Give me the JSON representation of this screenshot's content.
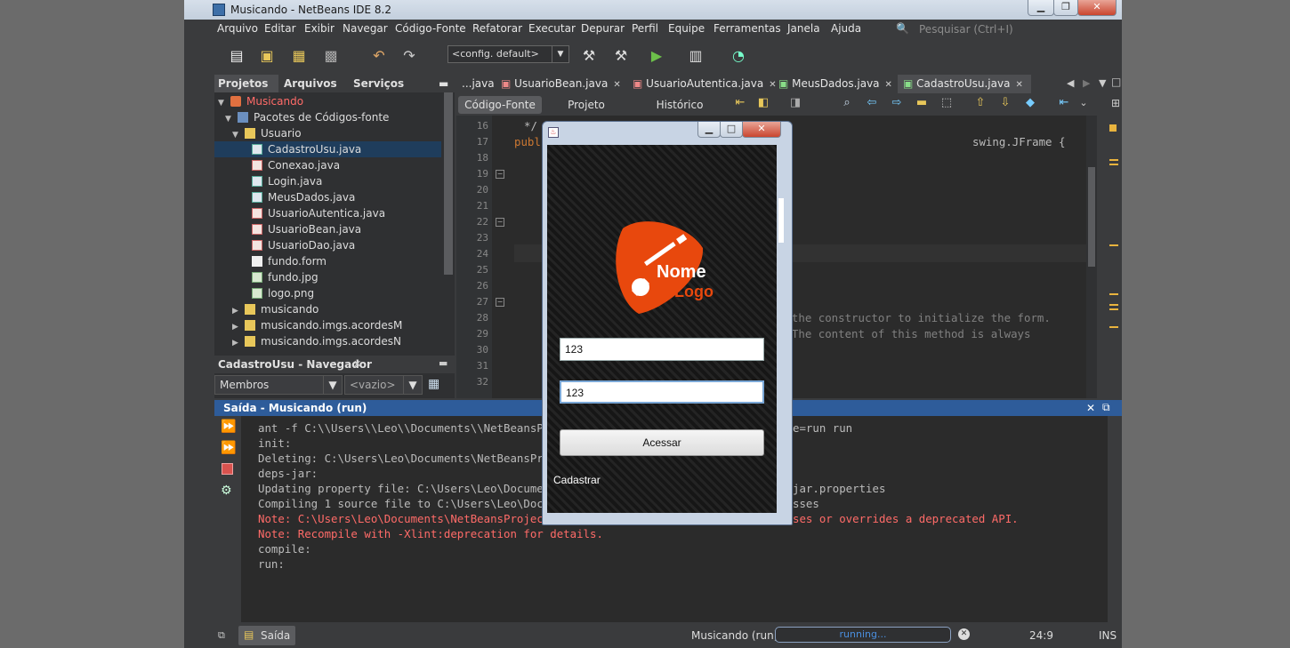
{
  "window": {
    "title": "Musicando - NetBeans IDE 8.2"
  },
  "menu": [
    "Arquivo",
    "Editar",
    "Exibir",
    "Navegar",
    "Código-Fonte",
    "Refatorar",
    "Executar",
    "Depurar",
    "Perfil",
    "Equipe",
    "Ferramentas",
    "Janela",
    "Ajuda"
  ],
  "search": {
    "placeholder": "Pesquisar (Ctrl+I)"
  },
  "toolbar": {
    "config": "<config. default>"
  },
  "left_tabs": [
    "Projetos",
    "Arquivos",
    "Serviços"
  ],
  "tree": [
    {
      "label": "Musicando",
      "icon": "project-icon",
      "color": "#ff6b68"
    },
    {
      "label": "Pacotes de Códigos-fonte",
      "icon": "source-packages-icon"
    },
    {
      "label": "Usuario",
      "icon": "package-icon"
    },
    {
      "label": "CadastroUsu.java",
      "icon": "java-form-icon"
    },
    {
      "label": "Conexao.java",
      "icon": "java-file-icon"
    },
    {
      "label": "Login.java",
      "icon": "java-form-icon"
    },
    {
      "label": "MeusDados.java",
      "icon": "java-form-icon"
    },
    {
      "label": "UsuarioAutentica.java",
      "icon": "java-file-icon"
    },
    {
      "label": "UsuarioBean.java",
      "icon": "java-file-icon"
    },
    {
      "label": "UsuarioDao.java",
      "icon": "java-file-icon"
    },
    {
      "label": "fundo.form",
      "icon": "form-file-icon"
    },
    {
      "label": "fundo.jpg",
      "icon": "image-file-icon"
    },
    {
      "label": "logo.png",
      "icon": "image-file-icon"
    },
    {
      "label": "musicando",
      "icon": "package-icon"
    },
    {
      "label": "musicando.imgs.acordesM",
      "icon": "package-icon"
    },
    {
      "label": "musicando.imgs.acordesN",
      "icon": "package-icon"
    }
  ],
  "navigator": {
    "title": "CadastroUsu - Navegador",
    "members": "Membros",
    "empty": "<vazio>"
  },
  "editor_tabs": [
    "...java",
    "UsuarioBean.java",
    "UsuarioAutentica.java",
    "MeusDados.java",
    "CadastroUsu.java"
  ],
  "sub_tabs": [
    "Código-Fonte",
    "Projeto",
    "Histórico"
  ],
  "line_numbers": [
    "16",
    "17",
    "18",
    "19",
    "20",
    "21",
    "22",
    "23",
    "24",
    "25",
    "26",
    "27",
    "28",
    "29",
    "30",
    "31",
    "32"
  ],
  "code": {
    "l16": "*/",
    "l17a": "publ",
    "l17b": "swing.JFrame {",
    "l28": "n the constructor to initialize the form.",
    "l29": ". The content of this method is always"
  },
  "output": {
    "title": "Saída - Musicando (run)",
    "lines": [
      {
        "text": "ant -f C:\\\\Users\\\\Leo\\\\Documents\\\\NetBeansProj",
        "tail": "e=run run",
        "red": false
      },
      {
        "text": "init:",
        "tail": "",
        "red": false
      },
      {
        "text": "Deleting: C:\\Users\\Leo\\Documents\\NetBeansProje",
        "tail": "",
        "red": false
      },
      {
        "text": "deps-jar:",
        "tail": "",
        "red": false
      },
      {
        "text": "Updating property file: C:\\Users\\Leo\\Document",
        "tail": "jar.properties",
        "red": false
      },
      {
        "text": "Compiling 1 source file to C:\\Users\\Leo\\Docume",
        "tail": "sses",
        "red": false
      },
      {
        "text": "Note: C:\\Users\\Leo\\Documents\\NetBeansProjects",
        "tail": "ses or overrides a deprecated API.",
        "red": true
      },
      {
        "text": "Note: Recompile with -Xlint:deprecation for details.",
        "tail": "",
        "red": true
      },
      {
        "text": "compile:",
        "tail": "",
        "red": false
      },
      {
        "text": "run:",
        "tail": "",
        "red": false
      }
    ]
  },
  "status": {
    "tab": "Saída",
    "project": "Musicando (run)",
    "progress": "running...",
    "position": "24:9",
    "mode": "INS"
  },
  "dialog": {
    "logo_line1": "Nome",
    "logo_line2": "Logo",
    "field1": "123",
    "field2": "123",
    "button": "Acessar",
    "link": "Cadastrar"
  },
  "colors": {
    "accent": "#2e5c9a",
    "error": "#ff6b68",
    "logo": "#e8480d"
  }
}
